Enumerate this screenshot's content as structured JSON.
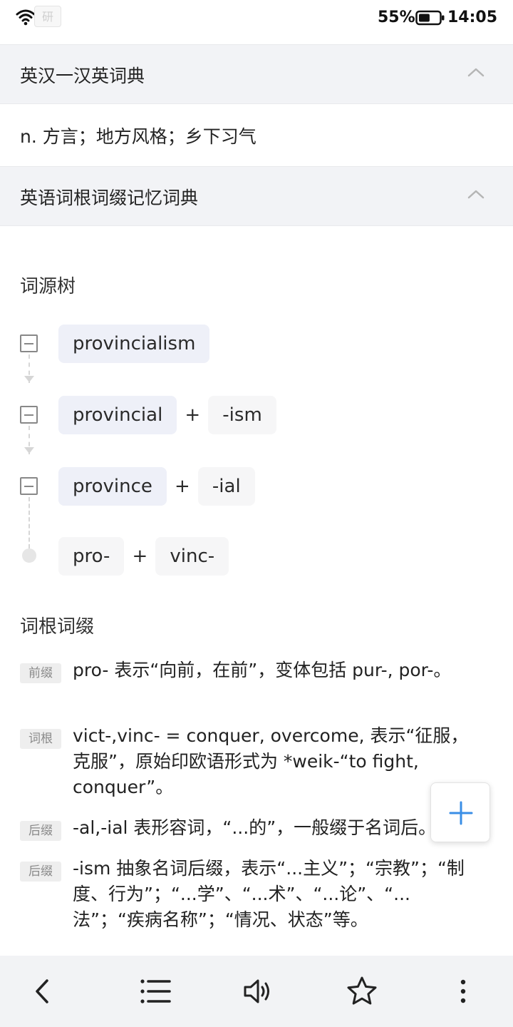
{
  "status_bar": {
    "chip_label": "研",
    "battery_percent": "55%",
    "battery_level": 0.55,
    "time": "14:05",
    "icons": [
      "wifi-icon",
      "battery-icon"
    ]
  },
  "sections": [
    {
      "title": "英汉一汉英词典",
      "expanded": true
    },
    {
      "title": "英语词根词缀记忆词典",
      "expanded": true
    }
  ],
  "definition": "n. 方言；地方风格；乡下习气",
  "etymology_tree": {
    "heading": "词源树",
    "rows": [
      {
        "parts": [
          "provincialism"
        ],
        "node": "collapse",
        "word_part": 0
      },
      {
        "parts": [
          "provincial",
          "-ism"
        ],
        "node": "collapse",
        "word_part": 0
      },
      {
        "parts": [
          "province",
          "-ial"
        ],
        "node": "collapse",
        "word_part": 0
      },
      {
        "parts": [
          "pro-",
          "vinc-"
        ],
        "node": "leaf",
        "word_part": -1
      }
    ],
    "plus": "+"
  },
  "roots_affixes": {
    "heading": "词根词缀",
    "items": [
      {
        "tag": "前缀",
        "text": "pro- 表示“向前，在前”，变体包括 pur-, por-。"
      },
      {
        "tag": "词根",
        "text": "vict-,vinc- = conquer, overcome, 表示“征服，克服”，原始印欧语形式为 *weik-“to fight, conquer”。"
      },
      {
        "tag": "后缀",
        "text": "-al,-ial 表形容词，“...的”，一般缀于名词后。"
      },
      {
        "tag": "后缀",
        "text": "-ism 抽象名词后缀，表示“...主义”；“宗教”；“制度、行为”；“...学”、“...术”、“...论”、“...法”；“疾病名称”；“情况、状态”等。"
      }
    ]
  },
  "fab": {
    "icon": "plus-icon",
    "color": "#3a8ee6"
  },
  "bottom_nav": {
    "icons": [
      "back-icon",
      "list-icon",
      "speaker-icon",
      "star-icon",
      "more-icon"
    ]
  }
}
